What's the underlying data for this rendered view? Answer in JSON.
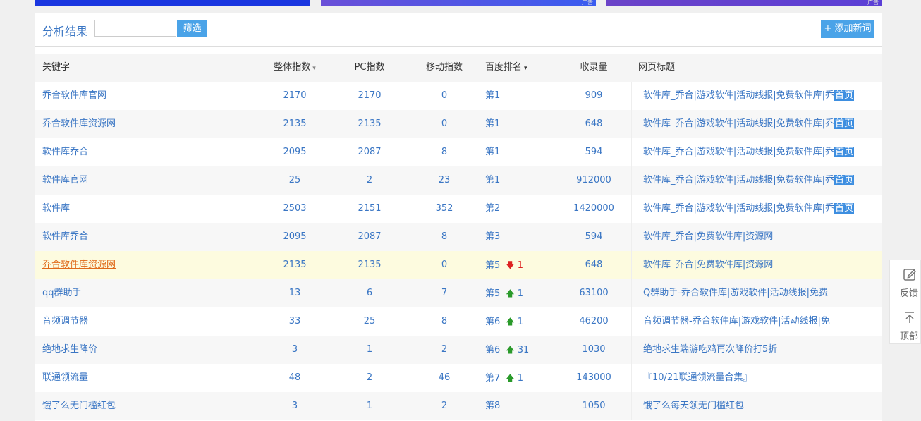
{
  "toolbar": {
    "title": "分析结果",
    "filter_placeholder": "",
    "filter_button": "筛选",
    "add_button": "+ 添加新词"
  },
  "columns": {
    "keyword": "关键字",
    "overall_index": "整体指数",
    "pc_index": "PC指数",
    "mobile_index": "移动指数",
    "baidu_rank": "百度排名",
    "indexed": "收录量",
    "page_title": "网页标题"
  },
  "sort_icons": {
    "down_triangle": "▾"
  },
  "rows": [
    {
      "keyword": "乔合软件库官网",
      "overall": "2170",
      "pc": "2170",
      "mobile": "0",
      "rank": "第1",
      "delta": "",
      "delta_dir": "",
      "indexed": "909",
      "title": "软件库_乔合|游戏软件|活动线报|免费软件库|乔",
      "title_mark": "首页"
    },
    {
      "keyword": "乔合软件库资源网",
      "overall": "2135",
      "pc": "2135",
      "mobile": "0",
      "rank": "第1",
      "delta": "",
      "delta_dir": "",
      "indexed": "648",
      "title": "软件库_乔合|游戏软件|活动线报|免费软件库|乔",
      "title_mark": "首页"
    },
    {
      "keyword": "软件库乔合",
      "overall": "2095",
      "pc": "2087",
      "mobile": "8",
      "rank": "第1",
      "delta": "",
      "delta_dir": "",
      "indexed": "594",
      "title": "软件库_乔合|游戏软件|活动线报|免费软件库|乔",
      "title_mark": "首页"
    },
    {
      "keyword": "软件库官网",
      "overall": "25",
      "pc": "2",
      "mobile": "23",
      "rank": "第1",
      "delta": "",
      "delta_dir": "",
      "indexed": "912000",
      "title": "软件库_乔合|游戏软件|活动线报|免费软件库|乔",
      "title_mark": "首页"
    },
    {
      "keyword": "软件库",
      "overall": "2503",
      "pc": "2151",
      "mobile": "352",
      "rank": "第2",
      "delta": "",
      "delta_dir": "",
      "indexed": "1420000",
      "title": "软件库_乔合|游戏软件|活动线报|免费软件库|乔",
      "title_mark": "首页"
    },
    {
      "keyword": "软件库乔合",
      "overall": "2095",
      "pc": "2087",
      "mobile": "8",
      "rank": "第3",
      "delta": "",
      "delta_dir": "",
      "indexed": "594",
      "title": "软件库_乔合|免费软件库|资源网",
      "title_mark": ""
    },
    {
      "keyword": "乔合软件库资源网",
      "overall": "2135",
      "pc": "2135",
      "mobile": "0",
      "rank": "第5",
      "delta": "1",
      "delta_dir": "down",
      "indexed": "648",
      "title": "软件库_乔合|免费软件库|资源网",
      "title_mark": ""
    },
    {
      "keyword": "qq群助手",
      "overall": "13",
      "pc": "6",
      "mobile": "7",
      "rank": "第5",
      "delta": "1",
      "delta_dir": "up",
      "indexed": "63100",
      "title": "Q群助手-乔合软件库|游戏软件|活动线报|免费",
      "title_mark": ""
    },
    {
      "keyword": "音频调节器",
      "overall": "33",
      "pc": "25",
      "mobile": "8",
      "rank": "第6",
      "delta": "1",
      "delta_dir": "up",
      "indexed": "46200",
      "title": "音频调节器-乔合软件库|游戏软件|活动线报|免",
      "title_mark": ""
    },
    {
      "keyword": "绝地求生降价",
      "overall": "3",
      "pc": "1",
      "mobile": "2",
      "rank": "第6",
      "delta": "31",
      "delta_dir": "up",
      "indexed": "1030",
      "title": "绝地求生端游吃鸡再次降价打5折",
      "title_mark": ""
    },
    {
      "keyword": "联通领流量",
      "overall": "48",
      "pc": "2",
      "mobile": "46",
      "rank": "第7",
      "delta": "1",
      "delta_dir": "up",
      "indexed": "143000",
      "title": "『10/21联通领流量合集』",
      "title_mark": ""
    },
    {
      "keyword": "饿了么无门槛红包",
      "overall": "3",
      "pc": "1",
      "mobile": "2",
      "rank": "第8",
      "delta": "",
      "delta_dir": "",
      "indexed": "1050",
      "title": "饿了么每天领无门槛红包",
      "title_mark": ""
    }
  ],
  "highlight_row": 6,
  "float_widget": {
    "feedback_label": "反馈",
    "feedback_icon": "edit-icon",
    "top_label": "顶部",
    "top_icon": "arrow-up-icon"
  },
  "colors": {
    "link": "#3a76c4",
    "accent_button": "#4aa3e8",
    "highlight_row_bg": "#fdfbdf",
    "highlight_link": "#e06a1a",
    "rank_down": "#dd2222",
    "rank_up": "#2a9a2a",
    "title_mark_bg": "#3d8ee0"
  }
}
